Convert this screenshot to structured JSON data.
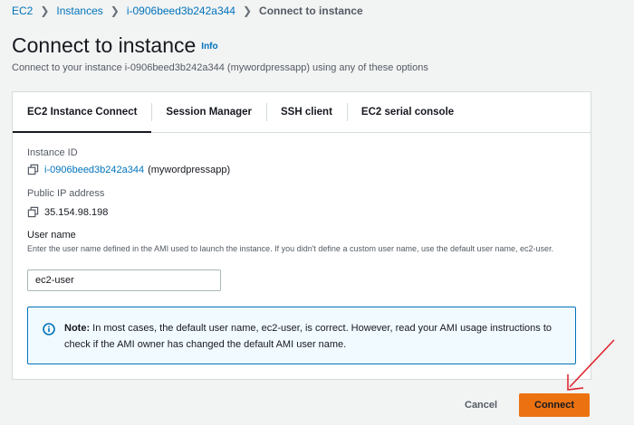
{
  "breadcrumb": {
    "items": [
      "EC2",
      "Instances",
      "i-0906beed3b242a344"
    ],
    "current": "Connect to instance"
  },
  "header": {
    "title": "Connect to instance",
    "info": "Info",
    "subtitle": "Connect to your instance i-0906beed3b242a344 (mywordpressapp) using any of these options"
  },
  "tabs": [
    {
      "label": "EC2 Instance Connect",
      "active": true
    },
    {
      "label": "Session Manager",
      "active": false
    },
    {
      "label": "SSH client",
      "active": false
    },
    {
      "label": "EC2 serial console",
      "active": false
    }
  ],
  "instance": {
    "id_label": "Instance ID",
    "id_value": "i-0906beed3b242a344",
    "id_name": "(mywordpressapp)",
    "ip_label": "Public IP address",
    "ip_value": "35.154.98.198"
  },
  "username": {
    "label": "User name",
    "hint": "Enter the user name defined in the AMI used to launch the instance. If you didn't define a custom user name, use the default user name, ec2-user.",
    "value": "ec2-user"
  },
  "note": {
    "bold": "Note:",
    "text": " In most cases, the default user name, ec2-user, is correct. However, read your AMI usage instructions to check if the AMI owner has changed the default AMI user name."
  },
  "actions": {
    "cancel": "Cancel",
    "connect": "Connect"
  },
  "colors": {
    "accent": "#0073bb",
    "primary_button": "#ec7211",
    "annotation_arrow": "#e0202a"
  }
}
